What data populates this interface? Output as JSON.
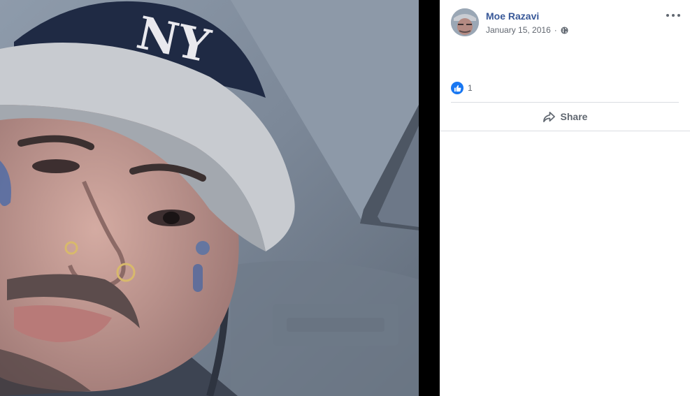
{
  "post": {
    "author": "Moe Razavi",
    "date": "January 15, 2016",
    "separator": "·",
    "privacy_icon": "globe-icon"
  },
  "menu": {
    "icon": "more-horizontal-icon"
  },
  "reactions": {
    "icon": "like-icon",
    "count": "1"
  },
  "actions": {
    "share_label": "Share",
    "share_icon": "share-arrow-icon"
  },
  "photo": {
    "cap_logo": "NY"
  },
  "colors": {
    "author_link": "#385898",
    "like_blue": "#1877f2",
    "muted_text": "#616770",
    "divider": "#dadde1"
  }
}
